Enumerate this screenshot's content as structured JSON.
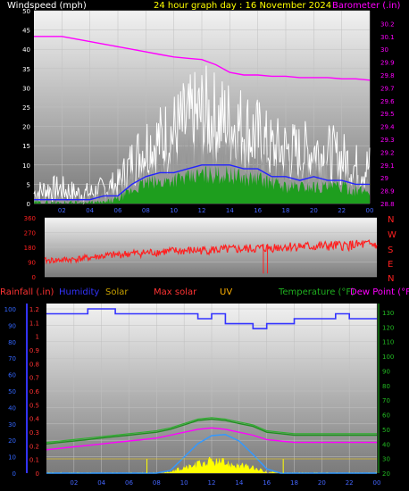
{
  "header": {
    "left_label": "Windspeed (mph)",
    "center_label": "24 hour graph day : 16 November 2024",
    "right_label": "Barometer (.in)"
  },
  "bottom_header": {
    "rainfall": "Rainfall (.in)",
    "humidity": "Humidity",
    "solar": "Solar",
    "max_solar": "Max solar",
    "uv": "UV",
    "temperature": "Temperature (°F)",
    "dew_point": "Dew Point (°F"
  },
  "colors": {
    "wind_gust": "#ffffff",
    "wind_avg": "#9a9a9a",
    "wind_speed": "#1e9e1e",
    "wind_blue": "#2222ff",
    "barometer": "#ff00ff",
    "direction": "#ff2020",
    "humidity": "#3333ff",
    "solar": "#ffff00",
    "max_solar": "#3399ff",
    "temperature": "#1f8f1f",
    "dew_point": "#ff00ff",
    "rainfall": "#ff3333"
  },
  "chart_data": [
    {
      "type": "line",
      "panel": "wind-barometer",
      "x_ticks": [
        "02",
        "04",
        "06",
        "08",
        "10",
        "12",
        "14",
        "16",
        "18",
        "20",
        "22",
        "00"
      ],
      "left_axis_ticks": [
        "0",
        "5",
        "10",
        "15",
        "20",
        "25",
        "30",
        "35",
        "40",
        "45",
        "50"
      ],
      "right_axis_ticks": [
        "28.8",
        "28.9",
        "29",
        "29.1",
        "29.2",
        "29.3",
        "29.4",
        "29.5",
        "29.6",
        "29.7",
        "29.8",
        "29.9",
        "30",
        "30.1",
        "30.2"
      ],
      "ylim_left": [
        0,
        50
      ],
      "ylim_right": [
        28.8,
        30.3
      ],
      "x_hours": [
        0,
        1,
        2,
        3,
        4,
        5,
        6,
        7,
        8,
        9,
        10,
        11,
        12,
        13,
        14,
        15,
        16,
        17,
        18,
        19,
        20,
        21,
        22,
        23,
        24
      ],
      "series": [
        {
          "name": "Barometer (.in)",
          "values": [
            30.1,
            30.1,
            30.1,
            30.08,
            30.06,
            30.04,
            30.02,
            30.0,
            29.98,
            29.96,
            29.94,
            29.93,
            29.92,
            29.88,
            29.82,
            29.8,
            29.8,
            29.79,
            29.79,
            29.78,
            29.78,
            29.78,
            29.77,
            29.77,
            29.76
          ]
        },
        {
          "name": "gust",
          "values": [
            2,
            3,
            3,
            2,
            2,
            3,
            4,
            9,
            13,
            14,
            16,
            18,
            20,
            19,
            18,
            17,
            15,
            12,
            12,
            11,
            12,
            11,
            10,
            8,
            8
          ]
        },
        {
          "name": "average",
          "values": [
            1,
            1,
            1,
            1,
            1,
            2,
            3,
            6,
            9,
            10,
            11,
            12,
            13,
            12,
            12,
            11,
            10,
            8,
            8,
            7,
            8,
            7,
            6,
            5,
            5
          ]
        },
        {
          "name": "speed",
          "values": [
            0,
            0,
            0,
            0,
            0,
            0,
            1,
            3,
            5,
            5,
            6,
            6,
            7,
            7,
            7,
            6,
            6,
            5,
            4,
            4,
            4,
            4,
            4,
            3,
            3
          ]
        },
        {
          "name": "average-line",
          "values": [
            1,
            1,
            1,
            1,
            1,
            2,
            2,
            5,
            7,
            8,
            8,
            9,
            10,
            10,
            10,
            9,
            9,
            7,
            7,
            6,
            7,
            6,
            6,
            5,
            5
          ]
        }
      ]
    },
    {
      "type": "line",
      "panel": "wind-direction",
      "left_axis_ticks": [
        "0",
        "90",
        "180",
        "270",
        "360"
      ],
      "right_axis_ticks": [
        "N",
        "W",
        "S",
        "E",
        "N"
      ],
      "ylim": [
        0,
        360
      ],
      "series": [
        {
          "name": "direction",
          "values": [
            95,
            98,
            102,
            110,
            120,
            128,
            135,
            140,
            145,
            150,
            152,
            155,
            158,
            160,
            162,
            165,
            170,
            175,
            180,
            178,
            180,
            182,
            185,
            188,
            190
          ]
        }
      ]
    },
    {
      "type": "line",
      "panel": "temperature-humidity",
      "left_axis_ticks": [
        "0",
        "10",
        "20",
        "30",
        "40",
        "50",
        "60",
        "70",
        "80",
        "90",
        "100"
      ],
      "rain_axis_ticks": [
        "0",
        "0.1",
        "0.2",
        "0.3",
        "0.4",
        "0.5",
        "0.6",
        "0.7",
        "0.8",
        "0.9",
        "1",
        "1.1",
        "1.2"
      ],
      "right_axis_ticks": [
        "20",
        "30",
        "40",
        "50",
        "60",
        "70",
        "80",
        "90",
        "100",
        "110",
        "120",
        "130"
      ],
      "x_ticks": [
        "02",
        "04",
        "06",
        "08",
        "10",
        "12",
        "14",
        "16",
        "18",
        "20",
        "22",
        "00"
      ],
      "series": [
        {
          "name": "Humidity",
          "values": [
            97,
            97,
            97,
            100,
            100,
            97,
            97,
            97,
            97,
            97,
            97,
            94,
            97,
            91,
            91,
            88,
            91,
            91,
            94,
            94,
            94,
            97,
            94,
            94,
            94
          ]
        },
        {
          "name": "Temperature (°F)",
          "values": [
            40,
            41,
            42,
            43,
            44,
            45,
            46,
            47,
            48,
            50,
            53,
            56,
            57,
            56,
            54,
            52,
            48,
            47,
            46,
            46,
            46,
            46,
            46,
            46,
            46
          ]
        },
        {
          "name": "Dew Point (°F",
          "values": [
            36,
            37,
            38,
            39,
            40,
            41,
            42,
            43,
            44,
            46,
            48,
            50,
            51,
            50,
            48,
            46,
            43,
            42,
            41,
            41,
            41,
            41,
            41,
            41,
            41
          ]
        },
        {
          "name": "Max solar",
          "values": [
            0,
            0,
            0,
            0,
            0,
            0,
            0,
            0,
            0,
            5,
            30,
            55,
            70,
            72,
            60,
            35,
            8,
            0,
            0,
            0,
            0,
            0,
            0,
            0,
            0
          ]
        },
        {
          "name": "Solar",
          "values": [
            0,
            0,
            0,
            0,
            0,
            0,
            0,
            0,
            0,
            1,
            6,
            10,
            14,
            12,
            9,
            6,
            1,
            0,
            0,
            0,
            0,
            0,
            0,
            0,
            0
          ]
        }
      ]
    }
  ]
}
